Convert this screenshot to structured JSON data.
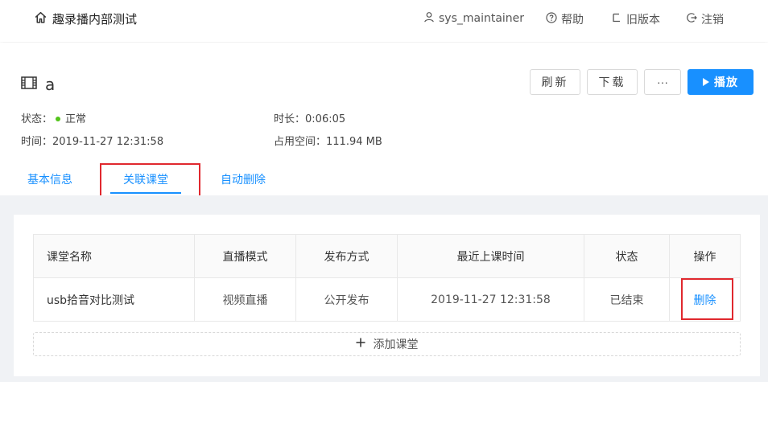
{
  "header": {
    "brand_title": "趣录播内部测试",
    "user": "sys_maintainer",
    "help": "帮助",
    "old_version": "旧版本",
    "logout": "注销"
  },
  "video": {
    "title": "a",
    "buttons": {
      "refresh": "刷新",
      "download": "下载",
      "more": "···",
      "play": "播放"
    },
    "status_label": "状态：",
    "status_value": "正常",
    "status_color": "#52c41a",
    "duration_label": "时长：",
    "duration_value": "0:06:05",
    "time_label": "时间：",
    "time_value": "2019-11-27 12:31:58",
    "space_label": "占用空间：",
    "space_value": "111.94 MB"
  },
  "tabs": [
    {
      "label": "基本信息",
      "active": false
    },
    {
      "label": "关联课堂",
      "active": true
    },
    {
      "label": "自动删除",
      "active": false
    }
  ],
  "table": {
    "columns": [
      "课堂名称",
      "直播模式",
      "发布方式",
      "最近上课时间",
      "状态",
      "操作"
    ],
    "rows": [
      {
        "name": "usb拾音对比测试",
        "mode": "视频直播",
        "publish": "公开发布",
        "last_time": "2019-11-27 12:31:58",
        "status": "已结束",
        "action": "删除"
      }
    ]
  },
  "add_classroom": "添加课堂",
  "colors": {
    "accent": "#1890ff",
    "highlight": "#e0282e",
    "background": "#f0f2f5"
  }
}
